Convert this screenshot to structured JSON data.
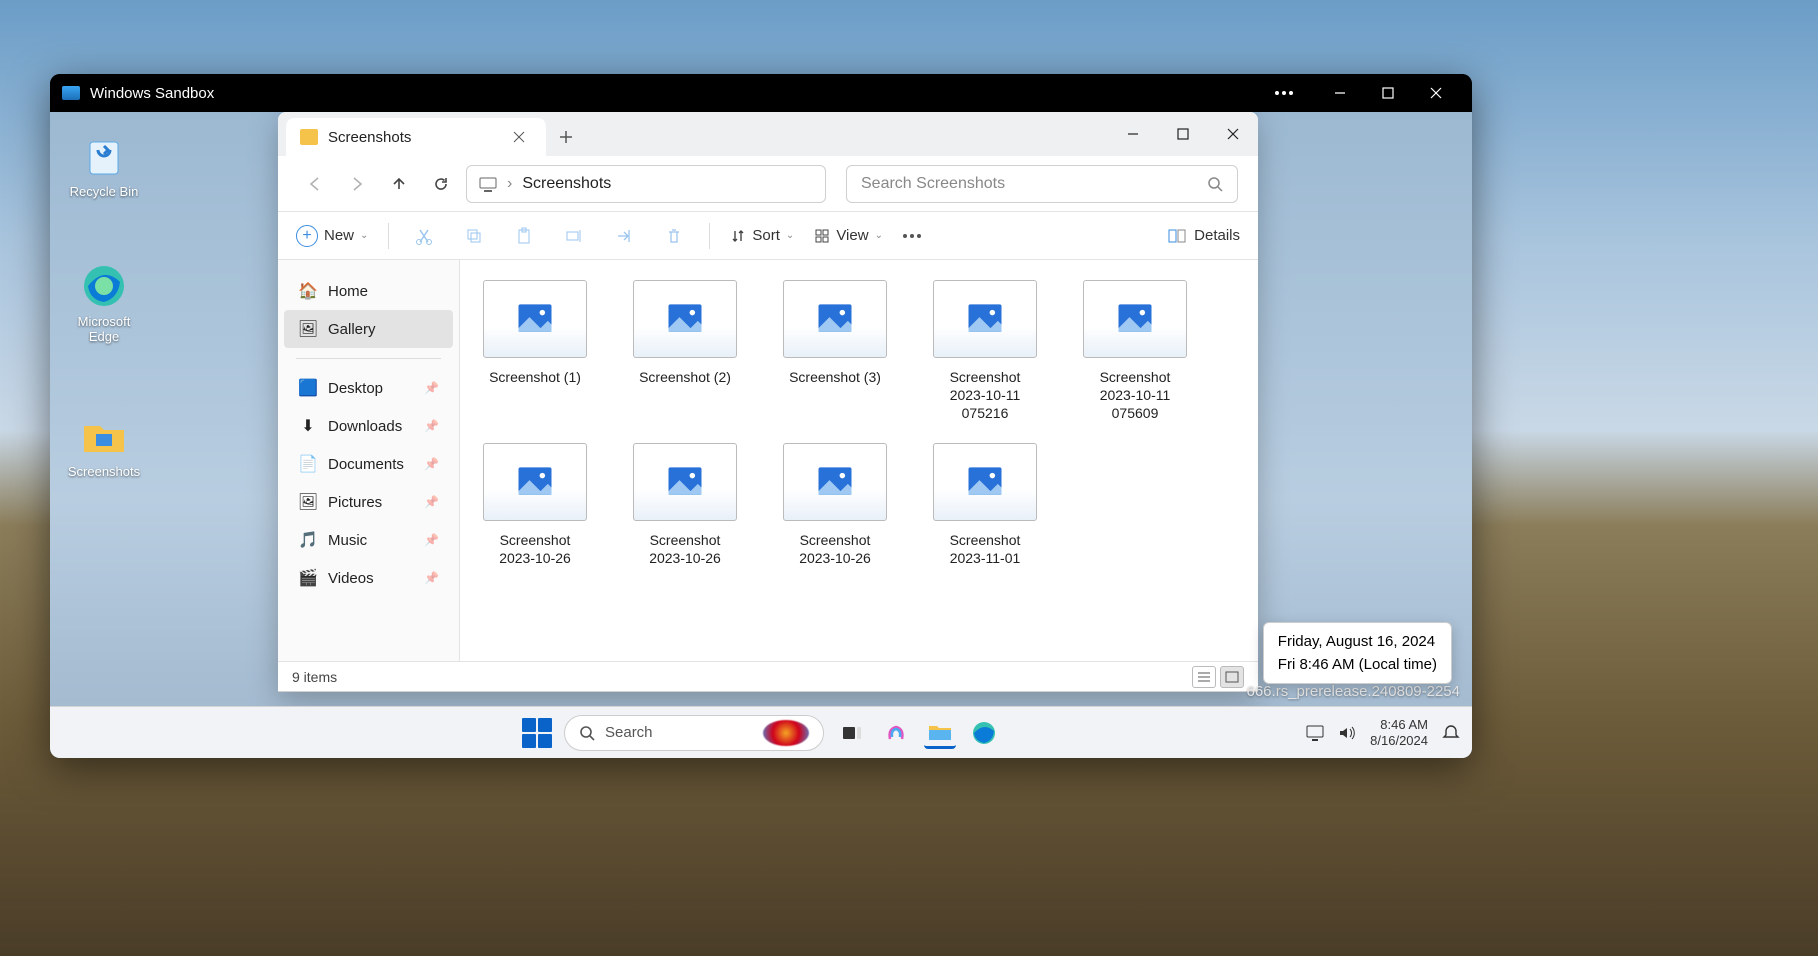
{
  "sandbox": {
    "title": "Windows Sandbox"
  },
  "desktop_icons": [
    {
      "name": "recycle-bin",
      "label": "Recycle Bin"
    },
    {
      "name": "edge",
      "label": "Microsoft Edge"
    },
    {
      "name": "screenshots-folder",
      "label": "Screenshots"
    }
  ],
  "explorer": {
    "tab_title": "Screenshots",
    "breadcrumb": "Screenshots",
    "search_placeholder": "Search Screenshots",
    "toolbar": {
      "new": "New",
      "sort": "Sort",
      "view": "View",
      "details": "Details"
    },
    "sidebar": {
      "top": [
        {
          "name": "home",
          "label": "Home",
          "icon": "🏠"
        },
        {
          "name": "gallery",
          "label": "Gallery",
          "icon": "🖼",
          "selected": true
        }
      ],
      "pinned": [
        {
          "name": "desktop",
          "label": "Desktop",
          "icon": "🟦"
        },
        {
          "name": "downloads",
          "label": "Downloads",
          "icon": "⬇"
        },
        {
          "name": "documents",
          "label": "Documents",
          "icon": "📄"
        },
        {
          "name": "pictures",
          "label": "Pictures",
          "icon": "🖼"
        },
        {
          "name": "music",
          "label": "Music",
          "icon": "🎵"
        },
        {
          "name": "videos",
          "label": "Videos",
          "icon": "🎬"
        }
      ]
    },
    "files": [
      {
        "label": "Screenshot (1)"
      },
      {
        "label": "Screenshot (2)"
      },
      {
        "label": "Screenshot (3)"
      },
      {
        "label": "Screenshot 2023-10-11 075216"
      },
      {
        "label": "Screenshot 2023-10-11 075609"
      },
      {
        "label": "Screenshot 2023-10-26"
      },
      {
        "label": "Screenshot 2023-10-26"
      },
      {
        "label": "Screenshot 2023-10-26"
      },
      {
        "label": "Screenshot 2023-11-01"
      }
    ],
    "status": "9 items"
  },
  "tooltip": {
    "line1": "Friday, August 16, 2024",
    "line2": "Fri 8:46 AM (Local time)"
  },
  "build_text": "666.rs_prerelease.240809-2254",
  "taskbar": {
    "search": "Search",
    "clock_time": "8:46 AM",
    "clock_date": "8/16/2024"
  }
}
